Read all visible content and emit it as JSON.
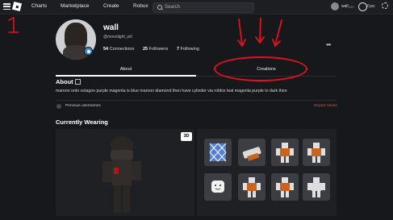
{
  "topnav": {
    "items": [
      "Charts",
      "Marketplace",
      "Create",
      "Robux"
    ],
    "search_placeholder": "Search",
    "username": "wall",
    "age_label": "13+",
    "robux_label": "0.pc"
  },
  "profile": {
    "display_name": "wall",
    "username": "@moonlight_w0",
    "connections_count": "54",
    "connections_label": "Connections",
    "followers_count": "25",
    "followers_label": "Followers",
    "following_count": "7",
    "following_label": "Following"
  },
  "tabs": [
    {
      "label": "About"
    },
    {
      "label": "Creations"
    }
  ],
  "about": {
    "heading": "About",
    "description": "maroon onto octagon purple magenta is blue maroon diamond then have cylinder via roblox teal magenta purple to dark then",
    "previous_usernames": "Previous usernames",
    "report_abuse": "Report Abuse"
  },
  "wearing": {
    "heading": "Currently Wearing",
    "view_3d_label": "3D"
  },
  "annotations": {
    "number_label": "1"
  },
  "colors": {
    "background": "#17181b",
    "topbar": "#1d1e22",
    "panel": "#1f2024",
    "tile": "#3c3e44",
    "annotation_red": "#e0121b",
    "report_red": "#e24b4b",
    "verified_blue": "#3d8be0"
  }
}
